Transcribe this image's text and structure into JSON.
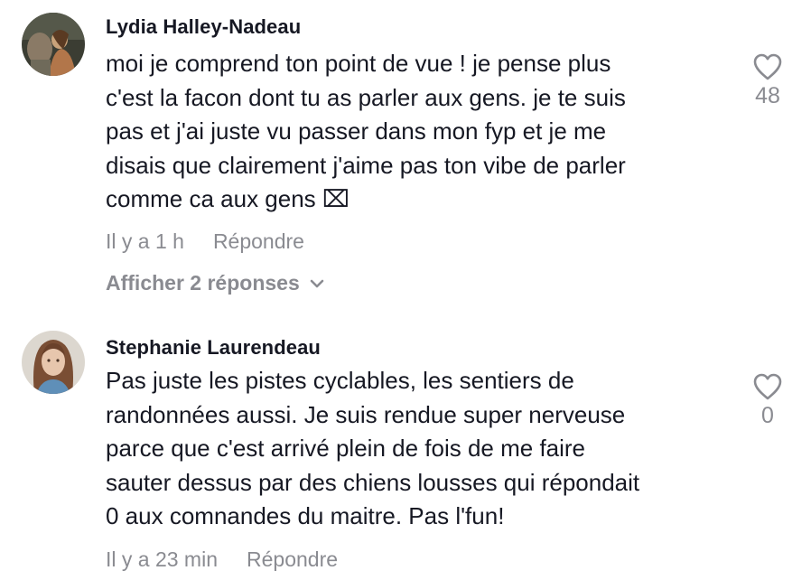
{
  "comments": [
    {
      "author": "Lydia Halley-Nadeau",
      "lines": [
        "moi je comprend ton point de vue ! je pense plus",
        "c'est la facon dont tu as parler aux gens. je te suis",
        "pas et j'ai juste vu passer dans mon fyp et je me",
        "disais que clairement j'aime pas ton vibe de parler",
        "comme ca aux gens ⌧"
      ],
      "time": "Il y a 1 h",
      "reply_label": "Répondre",
      "like_count": "48",
      "view_replies_label": "Afficher 2 réponses",
      "avatar_icon": "avatar-photo-icon",
      "avatar_colors": {
        "bg": "#3f4238",
        "accent": "#c8a27a"
      }
    },
    {
      "author": "Stephanie Laurendeau",
      "lines": [
        "Pas juste les pistes cyclables, les sentiers de",
        "randonnées aussi. Je suis rendue super nerveuse",
        "parce que c'est arrivé plein de fois de me faire",
        "sauter dessus par des chiens lousses qui répondait",
        "0 aux comnandes du maitre. Pas l'fun!"
      ],
      "time": "Il y a 23 min",
      "reply_label": "Répondre",
      "like_count": "0",
      "avatar_icon": "avatar-photo-icon",
      "avatar_colors": {
        "bg": "#dcd7cf",
        "accent": "#7a4e34"
      }
    }
  ],
  "colors": {
    "text": "#161823",
    "secondary": "#8a8b91",
    "heart_stroke": "#8a8b91"
  },
  "icons": {
    "like": "heart-outline-icon",
    "expand": "chevron-down-icon"
  }
}
